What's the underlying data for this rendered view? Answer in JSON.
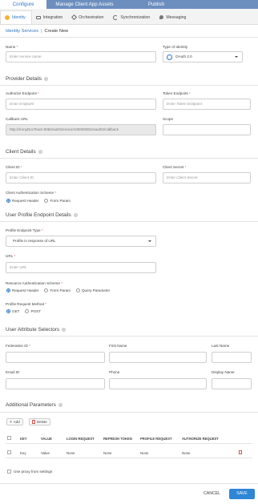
{
  "top_tabs": [
    "Configure Services",
    "Manage Client App Assets",
    "Publish"
  ],
  "sub_tabs": [
    {
      "label": "Identity",
      "icon": "identity-icon"
    },
    {
      "label": "Integration",
      "icon": "integration-icon"
    },
    {
      "label": "Orchestration",
      "icon": "orchestration-icon"
    },
    {
      "label": "Synchronization",
      "icon": "sync-icon"
    },
    {
      "label": "Messaging",
      "icon": "messaging-icon"
    }
  ],
  "breadcrumb": {
    "link": "Identity Services",
    "separator": "|",
    "current": "Create New"
  },
  "name": {
    "label": "Name",
    "placeholder": "Enter service name"
  },
  "type": {
    "label": "Type of Identity",
    "value": "OAuth 2.0"
  },
  "provider": {
    "title": "Provider Details",
    "authorize": {
      "label": "Authorize Endpoint",
      "placeholder": "Enter Endpoint"
    },
    "token": {
      "label": "Token Endpoint",
      "placeholder": "Enter Token Endpoint"
    },
    "callback": {
      "label": "Callback URL",
      "value": "http://KonyDocTeam:8084/authService/100000002/oauth2/callback"
    },
    "scope": {
      "label": "Scope",
      "value": ""
    }
  },
  "client": {
    "title": "Client Details",
    "id": {
      "label": "Client ID",
      "placeholder": "Enter Client ID"
    },
    "secret": {
      "label": "Client Secret",
      "placeholder": "Enter Client Secret"
    },
    "auth_scheme": {
      "label": "Client Authentication Scheme",
      "options": [
        "Request Header",
        "Form Param"
      ],
      "selected": "Request Header"
    }
  },
  "profile": {
    "title": "User Profile Endpoint Details",
    "type": {
      "label": "Profile Endpoint Type",
      "value": "Profile in response of URL"
    },
    "url": {
      "label": "URL",
      "placeholder": "Enter URL"
    },
    "resource_scheme": {
      "label": "Resource Authentication Scheme",
      "options": [
        "Request Header",
        "Form Param",
        "Query Parameter"
      ],
      "selected": "Request Header"
    },
    "method": {
      "label": "Profile Request Method",
      "options": [
        "GET",
        "POST"
      ],
      "selected": "GET"
    }
  },
  "attributes": {
    "title": "User Attribute Selectors",
    "federation_id": "Federation ID",
    "first_name": "First Name",
    "last_name": "Last Name",
    "email_id": "Email ID",
    "phone": "Phone",
    "display_name": "Display Name"
  },
  "params": {
    "title": "Additional Parameters",
    "add_label": "Add",
    "delete_label": "Delete",
    "columns": [
      "KEY",
      "VALUE",
      "LOGIN REQUEST",
      "REFRESH TOKEN",
      "PROFILE REQUEST",
      "AUTHORIZE REQUEST"
    ],
    "rows": [
      [
        "Key",
        "Value",
        "None",
        "None",
        "None",
        "None"
      ]
    ]
  },
  "proxy_label": "Use proxy from settings",
  "cancel_label": "CANCEL",
  "save_label": "SAVE",
  "colors": {
    "accent": "#2f76c6",
    "topbar": "#6c8ebf",
    "required": "#d9534f"
  }
}
